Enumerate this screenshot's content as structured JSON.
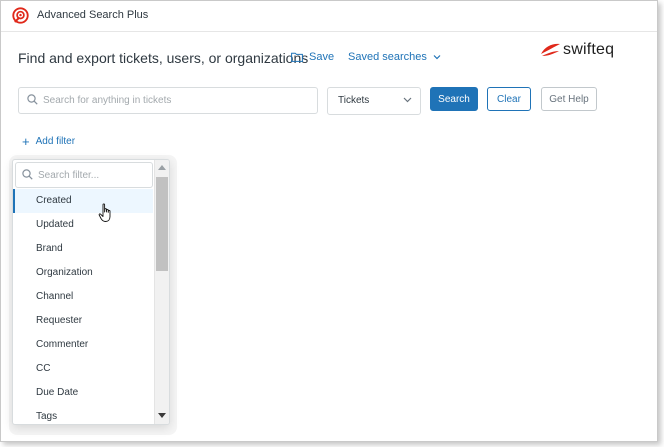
{
  "app": {
    "title": "Advanced Search Plus",
    "logo_icon": "app-logo-icon",
    "accent_color": "#e0281a"
  },
  "header": {
    "heading": "Find and export tickets, users, or organizations",
    "save_label": "Save",
    "saved_searches_label": "Saved searches",
    "brand_name": "swifteq"
  },
  "search": {
    "placeholder": "Search for anything in tickets",
    "value": "",
    "type_selected": "Tickets",
    "search_button": "Search",
    "clear_button": "Clear",
    "help_button": "Get Help",
    "primary_color": "#1f73b7"
  },
  "filters": {
    "add_filter_label": "Add filter",
    "search_placeholder": "Search filter...",
    "items": [
      {
        "label": "Created"
      },
      {
        "label": "Updated"
      },
      {
        "label": "Brand"
      },
      {
        "label": "Organization"
      },
      {
        "label": "Channel"
      },
      {
        "label": "Requester"
      },
      {
        "label": "Commenter"
      },
      {
        "label": "CC"
      },
      {
        "label": "Due Date"
      },
      {
        "label": "Tags"
      }
    ],
    "hovered_index": 0
  }
}
